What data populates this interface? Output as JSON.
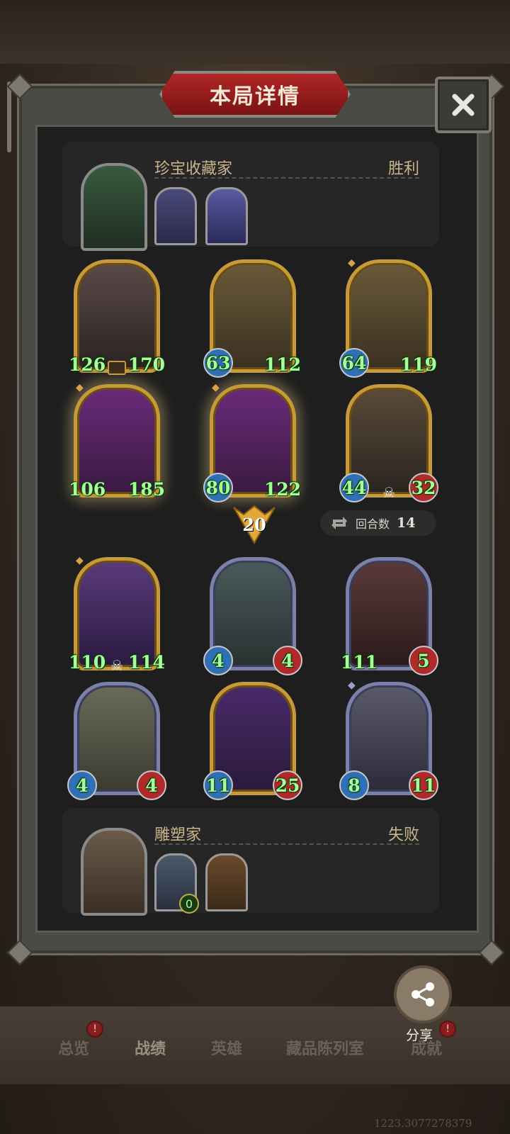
{
  "dialog": {
    "title": "本局详情"
  },
  "winner": {
    "name": "珍宝收藏家",
    "result": "胜利",
    "cards": [
      {
        "atk": "126",
        "hp": "170",
        "glow": false
      },
      {
        "atk": "63",
        "hp": "112",
        "glow": false
      },
      {
        "atk": "64",
        "hp": "119",
        "glow": false
      },
      {
        "atk": "106",
        "hp": "185",
        "glow": true
      },
      {
        "atk": "80",
        "hp": "122",
        "glow": true
      },
      {
        "atk": "44",
        "hp": "32",
        "glow": false
      }
    ]
  },
  "round": {
    "number": "20",
    "turns_label": "回合数",
    "turns_value": "14"
  },
  "loser": {
    "name": "雕塑家",
    "result": "失败",
    "cards": [
      {
        "atk": "110",
        "hp": "114"
      },
      {
        "atk": "4",
        "hp": "4"
      },
      {
        "atk": "111",
        "hp": "5"
      },
      {
        "atk": "4",
        "hp": "4"
      },
      {
        "atk": "11",
        "hp": "25"
      },
      {
        "atk": "8",
        "hp": "11"
      }
    ],
    "mini_badge": "0"
  },
  "share": {
    "label": "分享"
  },
  "nav": {
    "items": [
      "总览",
      "战绩",
      "英雄",
      "藏品陈列室",
      "成就"
    ],
    "badges": [
      "!",
      "!"
    ]
  },
  "version": "1223.3077278379",
  "colors": {
    "title_red": "#b02626",
    "gold_frame": "#c69a3a",
    "silver_frame": "#7b80a8",
    "stat_green": "#a6ff9a"
  }
}
